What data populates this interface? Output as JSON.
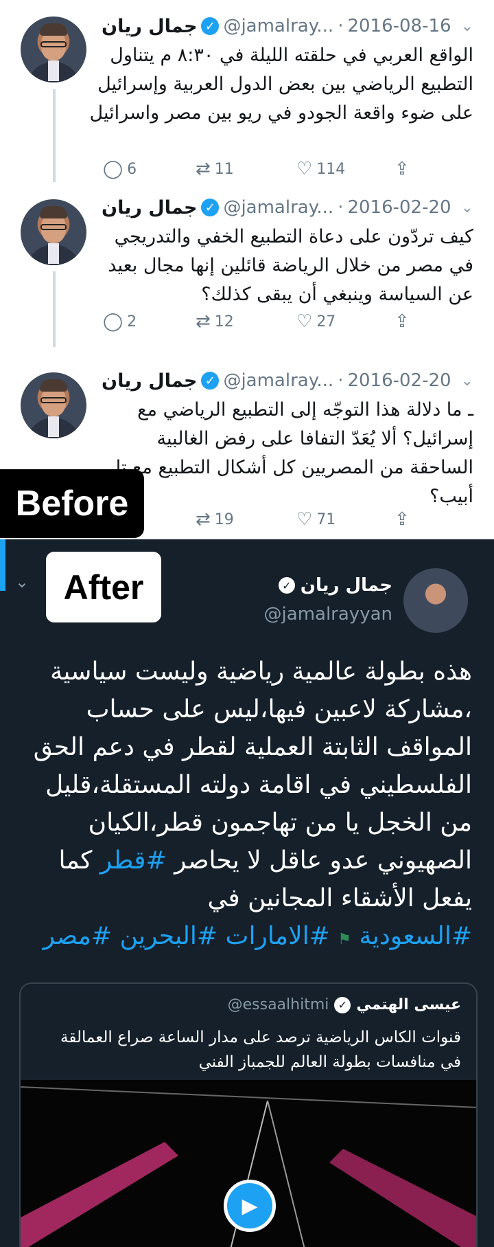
{
  "before_badge": "Before",
  "after_badge": "After",
  "light_tweets": [
    {
      "name": "جمال ريان",
      "handle": "@jamalray...",
      "date": "2016-08-16",
      "dot": "·",
      "text": "الواقع العربي في حلقته الليلة في ٨:٣٠ م يتناول التطبيع الرياضي بين بعض الدول العربية وإسرائيل على ضوء واقعة الجودو في ريو بين مصر واسرائيل",
      "replies": "6",
      "retweets": "11",
      "likes": "114"
    },
    {
      "name": "جمال ريان",
      "handle": "@jamalray...",
      "date": "2016-02-20",
      "dot": "·",
      "text": "كيف تردّون على دعاة التطبيع الخفي والتدريجي في مصر من خلال الرياضة قائلين إنها مجال بعيد عن السياسة وينبغي أن يبقى كذلك؟",
      "replies": "2",
      "retweets": "12",
      "likes": "27"
    },
    {
      "name": "جمال ريان",
      "handle": "@jamalray...",
      "date": "2016-02-20",
      "dot": "·",
      "text": "ـ ما دلالة هذا التوجّه إلى التطبيع الرياضي مع إسرائيل؟ ألا يُعَدّ التفافا على رفض الغالبية الساحقة من المصريين كل أشكال التطبيع مع تل أبيب؟",
      "replies": "",
      "retweets": "19",
      "likes": "71"
    }
  ],
  "dark_tweet": {
    "name": "جمال ريان",
    "handle": "@jamalrayyan",
    "text": "هذه بطولة عالمية رياضية وليست سياسية ،مشاركة لاعبين فيها،ليس على حساب المواقف الثابتة العملية لقطر في دعم الحق الفلسطيني في اقامة دولته المستقلة،قليل من الخجل يا من تهاجمون قطر،الكيان الصهيوني عدو عاقل لا يحاصر",
    "hashtag_inline": "#قطر",
    "text_after_hashtag": " كما يفعل الأشقاء المجانين في",
    "hashtags": [
      "#السعودية",
      "#الامارات",
      "#البحرين",
      "#مصر"
    ],
    "quote": {
      "name": "عيسى الهتمي",
      "handle": "@essaalhitmi",
      "text": "قنوات الكاس الرياضية ترصد على مدار الساعة صراع العمالقة في منافسات بطولة العالم للجمباز الفني"
    }
  },
  "icons": {
    "reply": "reply-icon",
    "retweet": "retweet-icon",
    "like": "heart-icon",
    "share": "share-icon",
    "verified": "verified-icon",
    "chevron": "chevron-down-icon",
    "play": "play-icon"
  },
  "colors": {
    "accent": "#1da1f2",
    "dark_bg": "#15202b",
    "text": "#14171a",
    "muted": "#657786"
  }
}
